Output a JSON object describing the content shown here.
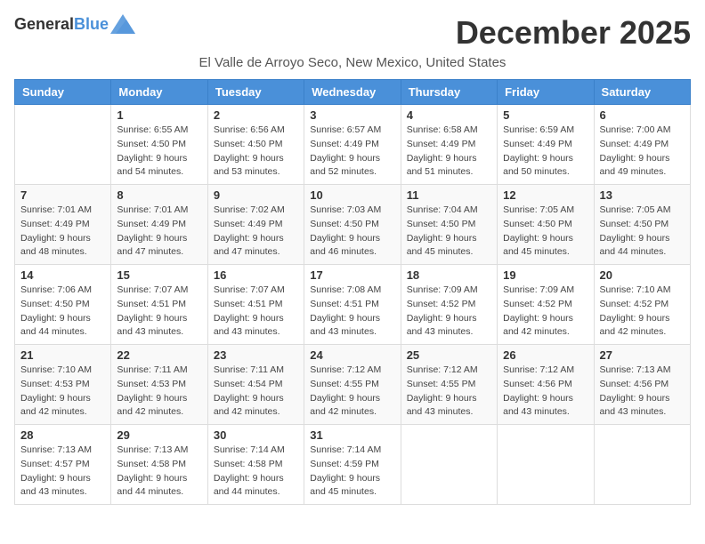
{
  "logo": {
    "general": "General",
    "blue": "Blue"
  },
  "title": "December 2025",
  "location": "El Valle de Arroyo Seco, New Mexico, United States",
  "days_of_week": [
    "Sunday",
    "Monday",
    "Tuesday",
    "Wednesday",
    "Thursday",
    "Friday",
    "Saturday"
  ],
  "weeks": [
    [
      {
        "day": "",
        "info": ""
      },
      {
        "day": "1",
        "info": "Sunrise: 6:55 AM\nSunset: 4:50 PM\nDaylight: 9 hours\nand 54 minutes."
      },
      {
        "day": "2",
        "info": "Sunrise: 6:56 AM\nSunset: 4:50 PM\nDaylight: 9 hours\nand 53 minutes."
      },
      {
        "day": "3",
        "info": "Sunrise: 6:57 AM\nSunset: 4:49 PM\nDaylight: 9 hours\nand 52 minutes."
      },
      {
        "day": "4",
        "info": "Sunrise: 6:58 AM\nSunset: 4:49 PM\nDaylight: 9 hours\nand 51 minutes."
      },
      {
        "day": "5",
        "info": "Sunrise: 6:59 AM\nSunset: 4:49 PM\nDaylight: 9 hours\nand 50 minutes."
      },
      {
        "day": "6",
        "info": "Sunrise: 7:00 AM\nSunset: 4:49 PM\nDaylight: 9 hours\nand 49 minutes."
      }
    ],
    [
      {
        "day": "7",
        "info": "Sunrise: 7:01 AM\nSunset: 4:49 PM\nDaylight: 9 hours\nand 48 minutes."
      },
      {
        "day": "8",
        "info": "Sunrise: 7:01 AM\nSunset: 4:49 PM\nDaylight: 9 hours\nand 47 minutes."
      },
      {
        "day": "9",
        "info": "Sunrise: 7:02 AM\nSunset: 4:49 PM\nDaylight: 9 hours\nand 47 minutes."
      },
      {
        "day": "10",
        "info": "Sunrise: 7:03 AM\nSunset: 4:50 PM\nDaylight: 9 hours\nand 46 minutes."
      },
      {
        "day": "11",
        "info": "Sunrise: 7:04 AM\nSunset: 4:50 PM\nDaylight: 9 hours\nand 45 minutes."
      },
      {
        "day": "12",
        "info": "Sunrise: 7:05 AM\nSunset: 4:50 PM\nDaylight: 9 hours\nand 45 minutes."
      },
      {
        "day": "13",
        "info": "Sunrise: 7:05 AM\nSunset: 4:50 PM\nDaylight: 9 hours\nand 44 minutes."
      }
    ],
    [
      {
        "day": "14",
        "info": "Sunrise: 7:06 AM\nSunset: 4:50 PM\nDaylight: 9 hours\nand 44 minutes."
      },
      {
        "day": "15",
        "info": "Sunrise: 7:07 AM\nSunset: 4:51 PM\nDaylight: 9 hours\nand 43 minutes."
      },
      {
        "day": "16",
        "info": "Sunrise: 7:07 AM\nSunset: 4:51 PM\nDaylight: 9 hours\nand 43 minutes."
      },
      {
        "day": "17",
        "info": "Sunrise: 7:08 AM\nSunset: 4:51 PM\nDaylight: 9 hours\nand 43 minutes."
      },
      {
        "day": "18",
        "info": "Sunrise: 7:09 AM\nSunset: 4:52 PM\nDaylight: 9 hours\nand 43 minutes."
      },
      {
        "day": "19",
        "info": "Sunrise: 7:09 AM\nSunset: 4:52 PM\nDaylight: 9 hours\nand 42 minutes."
      },
      {
        "day": "20",
        "info": "Sunrise: 7:10 AM\nSunset: 4:52 PM\nDaylight: 9 hours\nand 42 minutes."
      }
    ],
    [
      {
        "day": "21",
        "info": "Sunrise: 7:10 AM\nSunset: 4:53 PM\nDaylight: 9 hours\nand 42 minutes."
      },
      {
        "day": "22",
        "info": "Sunrise: 7:11 AM\nSunset: 4:53 PM\nDaylight: 9 hours\nand 42 minutes."
      },
      {
        "day": "23",
        "info": "Sunrise: 7:11 AM\nSunset: 4:54 PM\nDaylight: 9 hours\nand 42 minutes."
      },
      {
        "day": "24",
        "info": "Sunrise: 7:12 AM\nSunset: 4:55 PM\nDaylight: 9 hours\nand 42 minutes."
      },
      {
        "day": "25",
        "info": "Sunrise: 7:12 AM\nSunset: 4:55 PM\nDaylight: 9 hours\nand 43 minutes."
      },
      {
        "day": "26",
        "info": "Sunrise: 7:12 AM\nSunset: 4:56 PM\nDaylight: 9 hours\nand 43 minutes."
      },
      {
        "day": "27",
        "info": "Sunrise: 7:13 AM\nSunset: 4:56 PM\nDaylight: 9 hours\nand 43 minutes."
      }
    ],
    [
      {
        "day": "28",
        "info": "Sunrise: 7:13 AM\nSunset: 4:57 PM\nDaylight: 9 hours\nand 43 minutes."
      },
      {
        "day": "29",
        "info": "Sunrise: 7:13 AM\nSunset: 4:58 PM\nDaylight: 9 hours\nand 44 minutes."
      },
      {
        "day": "30",
        "info": "Sunrise: 7:14 AM\nSunset: 4:58 PM\nDaylight: 9 hours\nand 44 minutes."
      },
      {
        "day": "31",
        "info": "Sunrise: 7:14 AM\nSunset: 4:59 PM\nDaylight: 9 hours\nand 45 minutes."
      },
      {
        "day": "",
        "info": ""
      },
      {
        "day": "",
        "info": ""
      },
      {
        "day": "",
        "info": ""
      }
    ]
  ]
}
